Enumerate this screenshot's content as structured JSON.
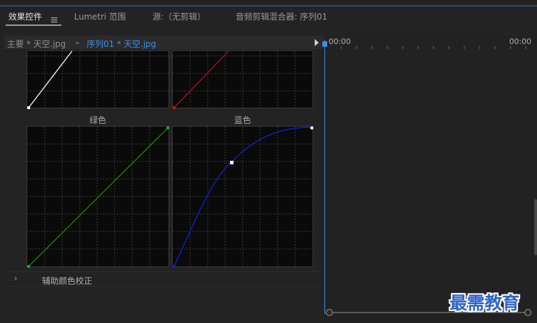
{
  "tabs": [
    {
      "label": "效果控件",
      "active": true
    },
    {
      "label": "Lumetri 范围",
      "active": false
    },
    {
      "label": "源:（无剪辑）",
      "active": false
    },
    {
      "label": "音频剪辑混合器: 序列01",
      "active": false
    }
  ],
  "clip_bar": {
    "master_clip": "主要 * 天空.jpg",
    "sequence_clip": "序列01 * 天空.jpg"
  },
  "curves": {
    "green_label": "绿色",
    "blue_label": "蓝色",
    "colors": {
      "white": "#ffffff",
      "red": "#c0141a",
      "green": "#1fa81f",
      "blue": "#1020c8"
    }
  },
  "secondary": {
    "label": "辅助颜色校正"
  },
  "timeline": {
    "start_timecode": "00:00",
    "end_timecode": "00:00",
    "playhead_color": "#3f8fe0"
  },
  "watermark": {
    "text": "最需教育"
  }
}
